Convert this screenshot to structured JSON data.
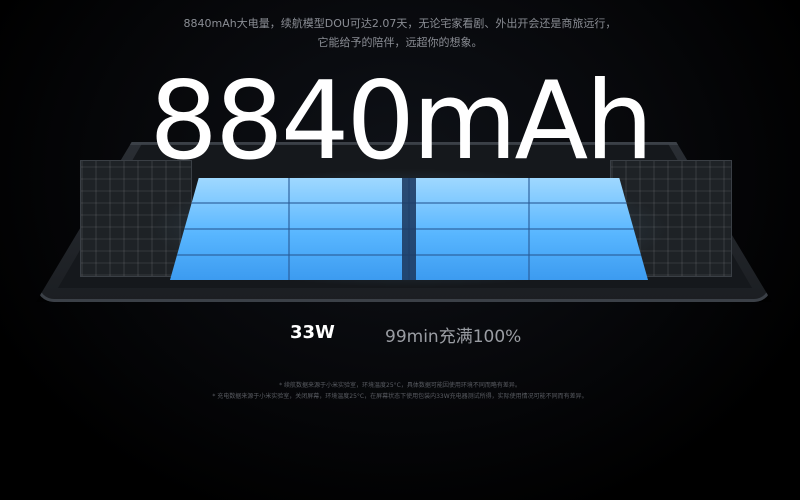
{
  "intro": {
    "line1": "8840mAh大电量，续航模型DOU可达2.07天，无论宅家看剧、外出开会还是商旅远行，",
    "line2": "它能给予的陪伴，远超你的想象。"
  },
  "headline": "8840mAh",
  "stats": {
    "power": "33W",
    "charge": "99min充满100%"
  },
  "footnotes": {
    "line1": "* 续航数据来源于小米实验室，环境温度25°C，具体数据可能因使用环境不同而略有差异。",
    "line2": "* 充电数据来源于小米实验室，关闭屏幕，环境温度25°C，在屏幕状态下使用包装内33W充电器测试所得，实际使用情况可能不同而有差异。"
  },
  "colors": {
    "background": "#000000",
    "battery_glow": "#58b6ff",
    "text_primary": "#ffffff",
    "text_secondary": "#9a9da3"
  }
}
